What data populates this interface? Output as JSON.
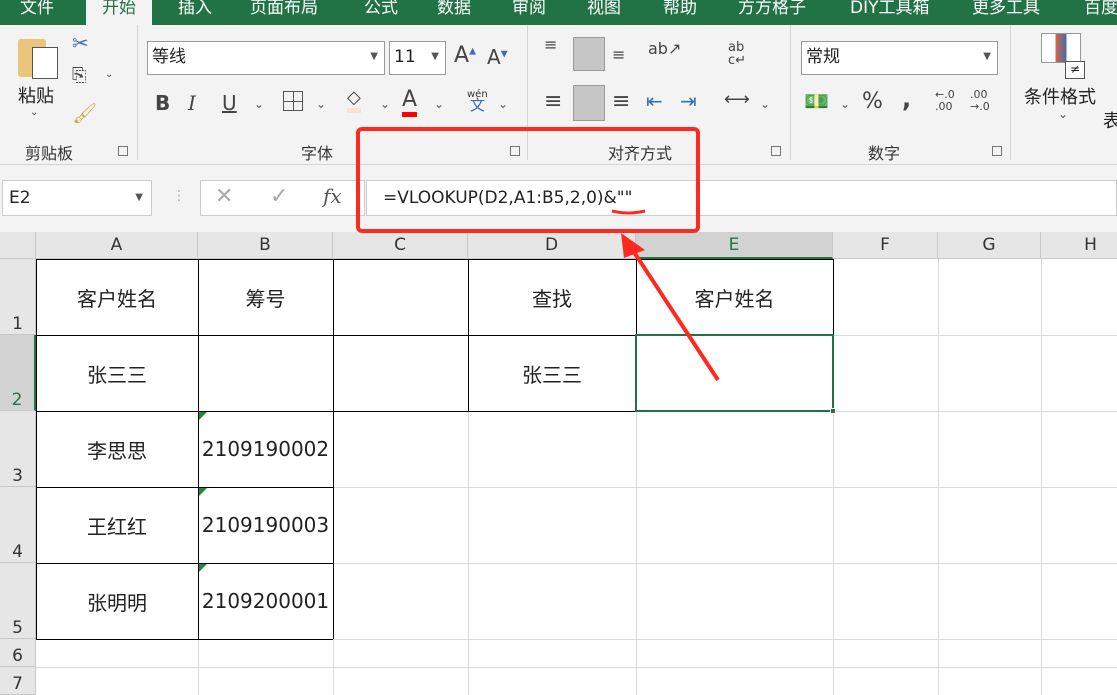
{
  "tabs": [
    "文件",
    "开始",
    "插入",
    "页面布局",
    "公式",
    "数据",
    "审阅",
    "视图",
    "帮助",
    "方方格子",
    "DIY工具箱",
    "更多工具",
    "百度"
  ],
  "ribbon": {
    "clipboard": {
      "label": "剪贴板",
      "paste": "粘贴"
    },
    "font": {
      "label": "字体",
      "font_name": "等线",
      "font_size": "11",
      "phonetic": "wén",
      "phonetic_char": "文"
    },
    "alignment": {
      "label": "对齐方式"
    },
    "number": {
      "label": "数字",
      "format": "常规",
      "percent": "%",
      "comma": ",",
      "inc_decimal": "←.0 .00",
      "dec_decimal": ".00 →.0"
    },
    "styles": {
      "conditional_format": "条件格式",
      "table_partial": "表"
    }
  },
  "formula_bar": {
    "name_box": "E2",
    "fx": "fx",
    "formula": "=VLOOKUP(D2,A1:B5,2,0)&\"\""
  },
  "columns": [
    "A",
    "B",
    "C",
    "D",
    "E",
    "F",
    "G",
    "H"
  ],
  "rows": [
    "1",
    "2",
    "3",
    "4",
    "5",
    "6",
    "7"
  ],
  "cells": {
    "A1": "客户姓名",
    "B1": "筹号",
    "D1": "查找",
    "E1": "客户姓名",
    "A2": "张三三",
    "D2": "张三三",
    "A3": "李思思",
    "B3": "2109190002",
    "A4": "王红红",
    "B4": "2109190003",
    "A5": "张明明",
    "B5": "2109200001"
  },
  "colors": {
    "accent": "#217346",
    "annotation": "#ff2a1f"
  }
}
